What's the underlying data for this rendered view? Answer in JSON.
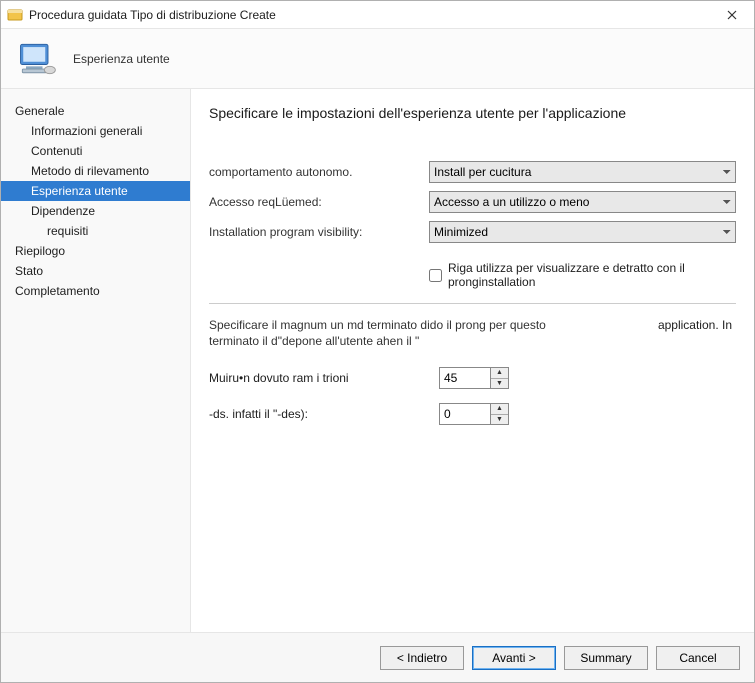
{
  "window": {
    "title": "Procedura guidata Tipo di distribuzione Create"
  },
  "header": {
    "step_name": "Esperienza utente"
  },
  "sidebar": {
    "items": [
      {
        "label": "Generale",
        "indent": 0
      },
      {
        "label": "Informazioni generali",
        "indent": 1
      },
      {
        "label": "Contenuti",
        "indent": 1
      },
      {
        "label": "Metodo di rilevamento",
        "indent": 1
      },
      {
        "label": "Esperienza utente",
        "indent": 1,
        "selected": true
      },
      {
        "label": "Dipendenze",
        "indent": 1
      },
      {
        "label": "requisiti",
        "indent": 2
      },
      {
        "label": "Riepilogo",
        "indent": 0
      },
      {
        "label": "Stato",
        "indent": 0
      },
      {
        "label": "Completamento",
        "indent": 0
      }
    ]
  },
  "content": {
    "heading": "Specificare le impostazioni dell'esperienza utente per l'applicazione",
    "rows": {
      "behavior_label": "comportamento autonomo.",
      "behavior_value": "Install per cucitura",
      "logon_label": "Accesso reqLüemed:",
      "logon_value": "Accesso a un utilizzo o meno",
      "visibility_label": "Installation program visibility:",
      "visibility_value": "Minimized"
    },
    "checkbox": {
      "label": "Riga utilizza per visualizzare e detratto con il pronginstallation",
      "checked": false
    },
    "note": {
      "left": "Specificare il magnum un md terminato dido il prong per questo terminato il d\"depone all'utente ahen il \"",
      "right": "application. In"
    },
    "numeric": {
      "runtime_label": "Muiru•n dovuto ram i trioni",
      "runtime_value": "45",
      "restart_label": "-ds. infatti il \"-des):",
      "restart_value": "0"
    }
  },
  "footer": {
    "back": "<  Indietro",
    "next": "Avanti >",
    "summary": "Summary",
    "cancel": "Cancel"
  }
}
